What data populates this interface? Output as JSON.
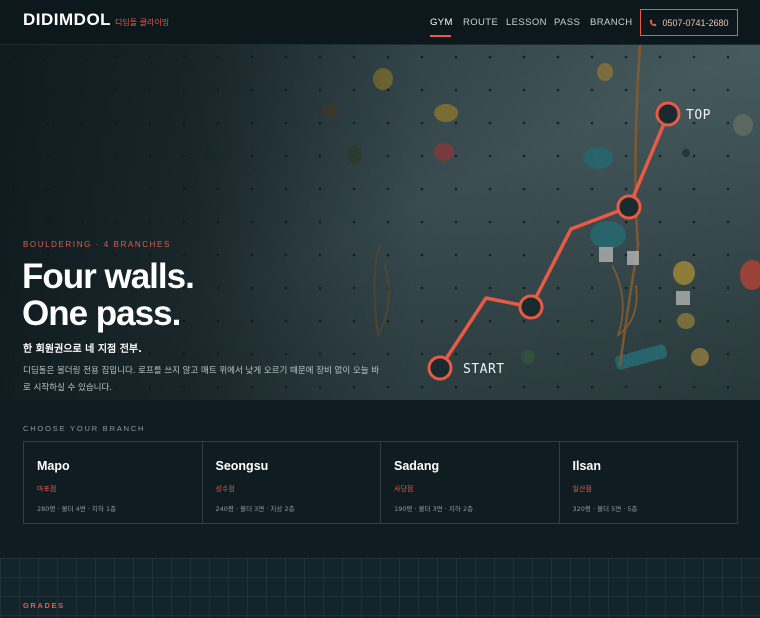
{
  "header": {
    "logo": "DIDIMDOL",
    "logo_sub": "디딤돌 클라이밍",
    "nav": [
      {
        "label": "GYM",
        "active": true
      },
      {
        "label": "ROUTE",
        "active": false
      },
      {
        "label": "LESSON",
        "active": false
      },
      {
        "label": "PASS",
        "active": false
      },
      {
        "label": "BRANCH",
        "active": false
      }
    ],
    "phone": "0507-0741-2680"
  },
  "hero": {
    "eyebrow": "BOULDERING · 4 BRANCHES",
    "headline_line1": "Four walls.",
    "headline_line2": "One pass.",
    "kr_title": "한 회원권으로 네 지점 전부.",
    "kr_desc": "디딤돌은 볼더링 전용 짐입니다. 로프를 쓰지 않고 매트 위에서 낮게 오르기 때문에 장비 없이 오늘 바로 시작하실 수 있습니다.",
    "route_start": "START",
    "route_top": "TOP"
  },
  "branches": {
    "label": "CHOOSE YOUR BRANCH",
    "items": [
      {
        "name": "Mapo",
        "kr": "마포점",
        "info": "280평 · 볼더 4면 · 지하 1층"
      },
      {
        "name": "Seongsu",
        "kr": "성수점",
        "info": "240평 · 볼더 3면 · 지상 2층"
      },
      {
        "name": "Sadang",
        "kr": "사당점",
        "info": "190평 · 볼더 3면 · 지하 2층"
      },
      {
        "name": "Ilsan",
        "kr": "일산점",
        "info": "320평 · 볼더 5면 · 5층"
      }
    ]
  },
  "grades": {
    "label": "GRADES"
  },
  "colors": {
    "accent": "#e85a45",
    "background": "#0f1d22"
  }
}
